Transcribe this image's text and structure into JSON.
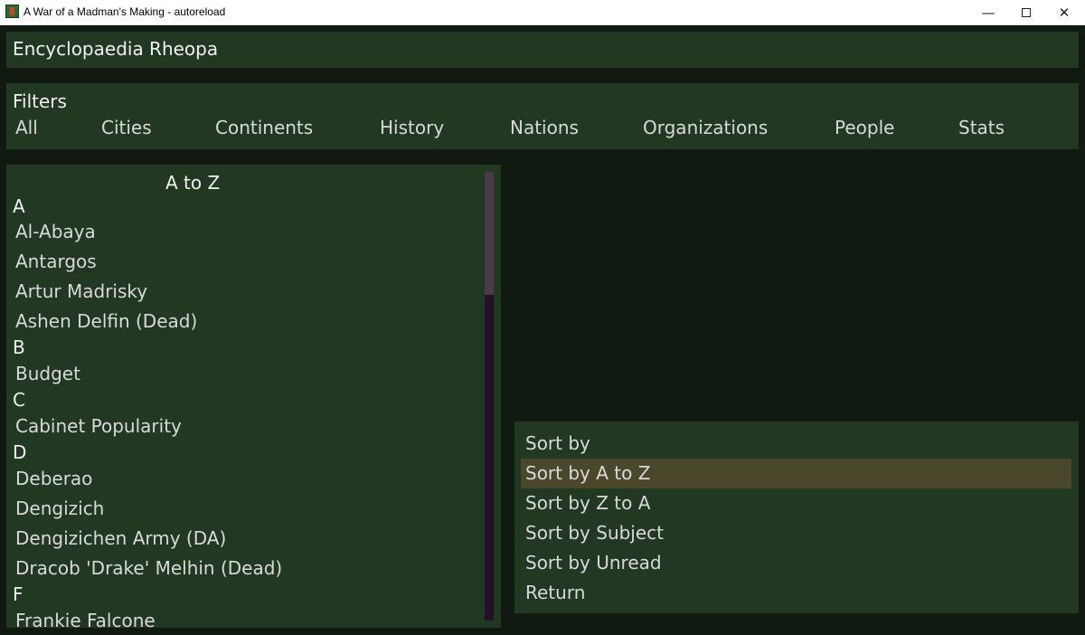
{
  "window": {
    "title": "A War of a Madman's Making - autoreload",
    "minimize_glyph": "—",
    "close_glyph": "✕"
  },
  "header": {
    "title": "Encyclopaedia Rheopa"
  },
  "filters": {
    "heading": "Filters",
    "items": [
      "All",
      "Cities",
      "Continents",
      "History",
      "Nations",
      "Organizations",
      "People",
      "Stats"
    ]
  },
  "list": {
    "sort_title": "A to Z",
    "groups": [
      {
        "letter": "A",
        "entries": [
          "Al-Abaya",
          "Antargos",
          "Artur Madrisky",
          "Ashen Delfin (Dead)"
        ]
      },
      {
        "letter": "B",
        "entries": [
          "Budget"
        ]
      },
      {
        "letter": "C",
        "entries": [
          "Cabinet Popularity"
        ]
      },
      {
        "letter": "D",
        "entries": [
          "Deberao",
          "Dengizich",
          "Dengizichen Army (DA)",
          "Dracob 'Drake' Melhin (Dead)"
        ]
      },
      {
        "letter": "F",
        "entries": [
          "Frankie Falcone"
        ]
      }
    ]
  },
  "sort_menu": {
    "items": [
      "Sort by",
      "Sort by A to Z",
      "Sort by Z to A",
      "Sort by Subject",
      "Sort by Unread",
      "Return"
    ],
    "selected": "Sort by A to Z"
  },
  "colors": {
    "background": "#111a11",
    "panel": "#223822",
    "selected": "#4a482a",
    "scroll_track": "#25102a",
    "scroll_thumb": "#4a3a4c"
  }
}
